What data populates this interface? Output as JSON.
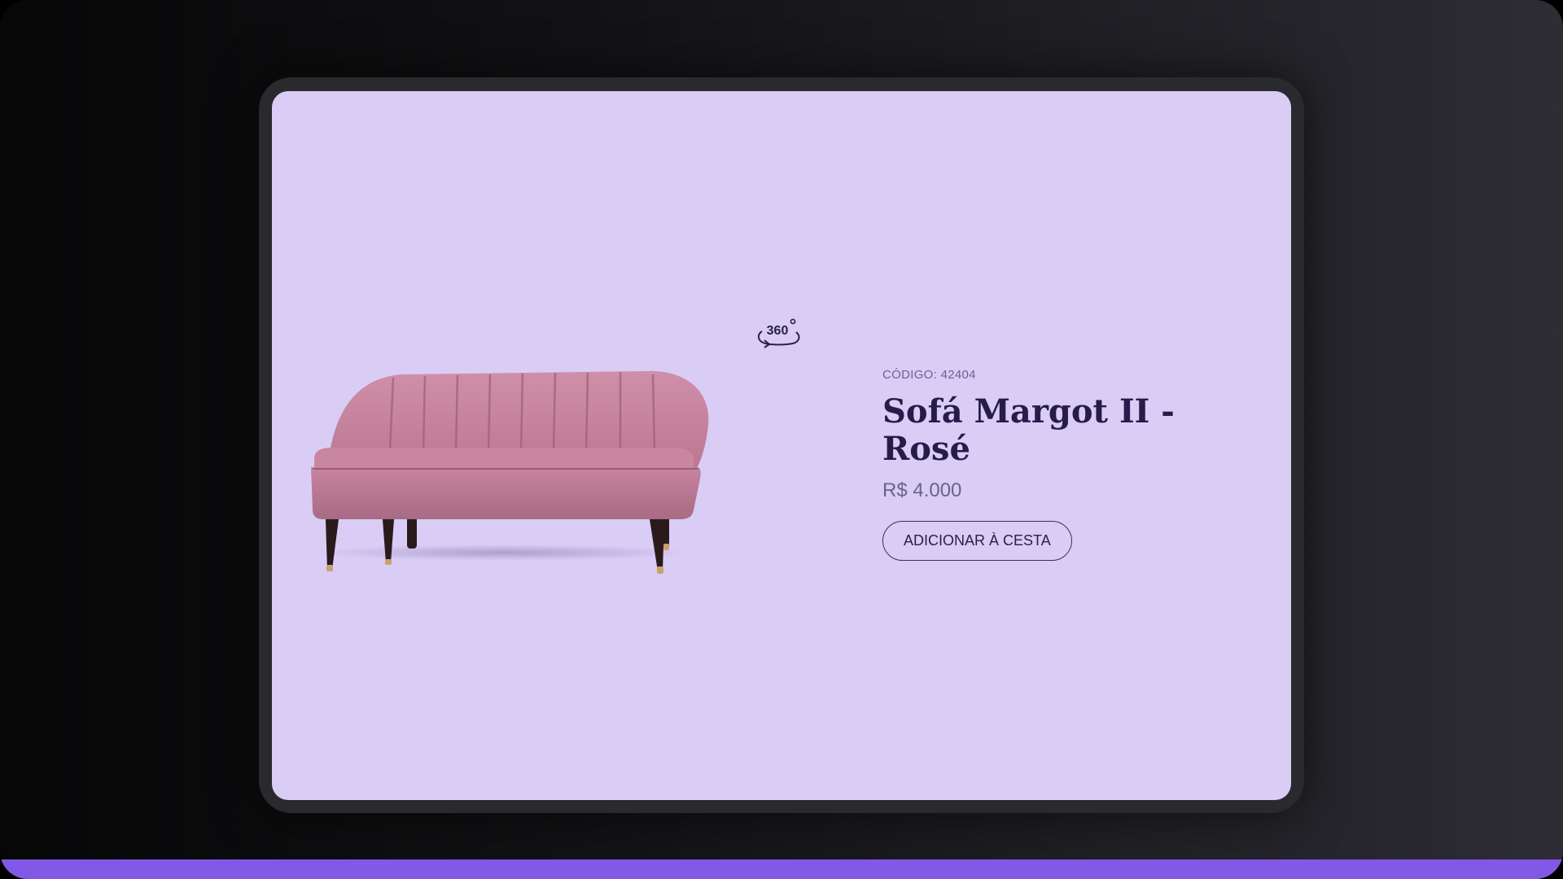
{
  "colors": {
    "screen_background": "#d9cdf6",
    "title_color": "#271b4b",
    "accent_bar": "#8258e6",
    "sofa_fabric": "#c47f9b"
  },
  "viewer": {
    "rotate_icon": "360-rotate-icon",
    "rotate_icon_text": "360"
  },
  "product": {
    "code_label": "CÓDIGO:",
    "code_value": "42404",
    "name": "Sofá Margot II - Rosé",
    "price": "R$ 4.000",
    "add_to_cart_label": "ADICIONAR À CESTA",
    "image": "pink-tufted-sofa"
  }
}
